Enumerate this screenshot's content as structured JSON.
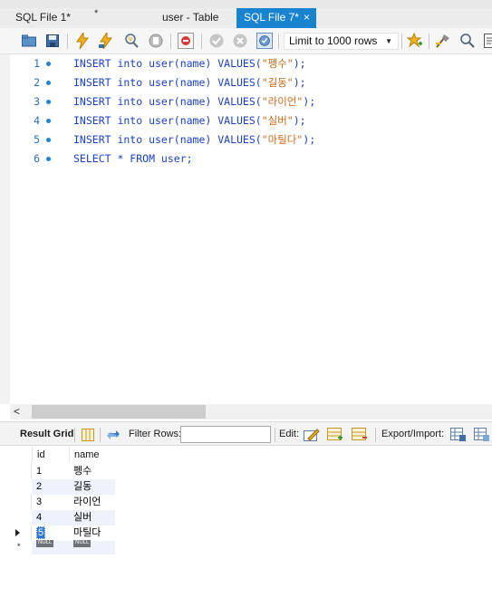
{
  "tabs": [
    {
      "label": "SQL File 1*",
      "marker": "*"
    },
    {
      "label": "user - Table"
    },
    {
      "label": "SQL File 7*",
      "close": "×",
      "active": true
    }
  ],
  "toolbar": {
    "limit_label": "Limit to 1000 rows",
    "icons": [
      "open-folder-icon",
      "save-icon",
      "execute-icon",
      "execute-current-icon",
      "explain-icon",
      "stop-icon",
      "toggle-error-icon",
      "commit-icon",
      "rollback-icon",
      "autocommit-icon",
      "limit-rows-select",
      "add-snippet-icon",
      "beautify-icon",
      "find-icon",
      "word-wrap-icon"
    ]
  },
  "editor": {
    "lines": [
      {
        "num": "1",
        "kw": "INSERT into user(name) VALUES(",
        "str": "\"펭수\"",
        "end": ");"
      },
      {
        "num": "2",
        "kw": "INSERT into user(name) VALUES(",
        "str": "\"길동\"",
        "end": ");"
      },
      {
        "num": "3",
        "kw": "INSERT into user(name) VALUES(",
        "str": "\"라이언\"",
        "end": ");"
      },
      {
        "num": "4",
        "kw": "INSERT into user(name) VALUES(",
        "str": "\"실버\"",
        "end": ");"
      },
      {
        "num": "5",
        "kw": "INSERT into user(name) VALUES(",
        "str": "\"마틸다\"",
        "end": ");"
      },
      {
        "num": "6",
        "kw": "SELECT * FROM user;",
        "str": "",
        "end": ""
      }
    ]
  },
  "results_toolbar": {
    "result_grid": "Result Grid",
    "filter_rows": "Filter Rows:",
    "filter_value": "",
    "edit": "Edit:",
    "export_import": "Export/Import:"
  },
  "grid": {
    "columns": [
      "id",
      "name"
    ],
    "rows": [
      {
        "id": "1",
        "name": "펭수"
      },
      {
        "id": "2",
        "name": "길동"
      },
      {
        "id": "3",
        "name": "라이언"
      },
      {
        "id": "4",
        "name": "실버"
      },
      {
        "id": "5",
        "name": "마틸다"
      }
    ],
    "new_row": {
      "id": "NULL",
      "name": "NULL",
      "marker": "*"
    }
  },
  "colors": {
    "active_tab": "#1884d0",
    "keyword": "#1a40c8",
    "string": "#c86a1a",
    "line_number": "#2a6fb5",
    "row_alt": "#eef2fb",
    "selection": "#2d79d4"
  }
}
